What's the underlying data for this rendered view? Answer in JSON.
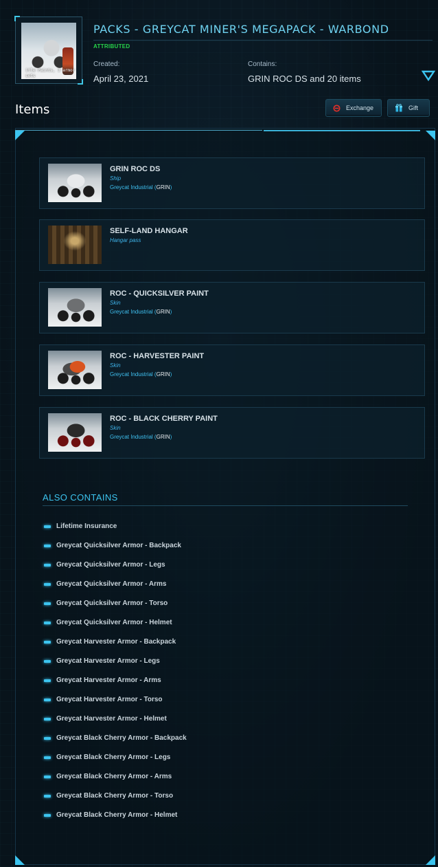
{
  "pack": {
    "title": "PACKS - GREYCAT MINER'S MEGAPACK - WARBOND",
    "status": "ATTRIBUTED",
    "thumb_caption": "itle Paints, 3 armor sets",
    "created_label": "Created:",
    "created_value": "April 23, 2021",
    "contains_label": "Contains:",
    "contains_value": "GRIN ROC DS and 20 items"
  },
  "section": {
    "items_heading": "Items",
    "exchange_label": "Exchange",
    "gift_label": "Gift"
  },
  "items": [
    {
      "name": "GRIN ROC DS",
      "type": "Ship",
      "manufacturer": "Greycat Industrial",
      "code": "GRIN"
    },
    {
      "name": "SELF-LAND HANGAR",
      "type": "Hangar pass"
    },
    {
      "name": "ROC - QUICKSILVER PAINT",
      "type": "Skin",
      "manufacturer": "Greycat Industrial",
      "code": "GRIN"
    },
    {
      "name": "ROC - HARVESTER PAINT",
      "type": "Skin",
      "manufacturer": "Greycat Industrial",
      "code": "GRIN"
    },
    {
      "name": "ROC - BLACK CHERRY PAINT",
      "type": "Skin",
      "manufacturer": "Greycat Industrial",
      "code": "GRIN"
    }
  ],
  "also_contains": {
    "heading": "ALSO CONTAINS",
    "items": [
      "Lifetime Insurance",
      "Greycat Quicksilver Armor - Backpack",
      "Greycat Quicksilver Armor - Legs",
      "Greycat Quicksilver Armor - Arms",
      "Greycat Quicksilver Armor - Torso",
      "Greycat Quicksilver Armor - Helmet",
      "Greycat Harvester Armor - Backpack",
      "Greycat Harvester Armor - Legs",
      "Greycat Harvester Armor - Arms",
      "Greycat Harvester Armor - Torso",
      "Greycat Harvester Armor - Helmet",
      "Greycat Black Cherry Armor - Backpack",
      "Greycat Black Cherry Armor - Legs",
      "Greycat Black Cherry Armor - Arms",
      "Greycat Black Cherry Armor - Torso",
      "Greycat Black Cherry Armor - Helmet"
    ]
  },
  "icons": {
    "expand": "chevron-down-icon",
    "exchange": "exchange-icon",
    "gift": "gift-icon",
    "bullet": "bullet-dash-icon"
  },
  "colors": {
    "accent": "#3cc4ef",
    "title": "#6fd2f0",
    "status": "#27d44a",
    "background": "#0a1620"
  }
}
